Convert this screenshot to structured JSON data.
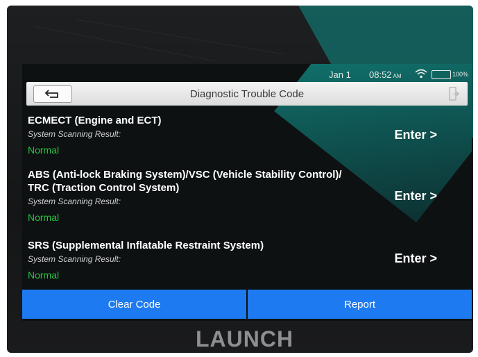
{
  "status_bar": {
    "date": "Jan 1",
    "time": "08:52",
    "ampm": "AM",
    "battery_percent": "100%"
  },
  "header": {
    "title": "Diagnostic Trouble Code",
    "back_icon": "back-arrow-icon",
    "exit_icon": "exit-door-icon"
  },
  "systems": [
    {
      "name_line1": "ECMECT (Engine and ECT)",
      "name_line2": "",
      "result_label": "System Scanning Result:",
      "result_value": "Normal",
      "enter_label": "Enter >"
    },
    {
      "name_line1": "ABS (Anti-lock Braking System)/VSC (Vehicle Stability Control)/",
      "name_line2": "TRC (Traction Control System)",
      "result_label": "System Scanning Result:",
      "result_value": "Normal",
      "enter_label": "Enter >"
    },
    {
      "name_line1": "SRS (Supplemental Inflatable Restraint System)",
      "name_line2": "",
      "result_label": "System Scanning Result:",
      "result_value": "Normal",
      "enter_label": "Enter >"
    }
  ],
  "footer": {
    "clear_label": "Clear Code",
    "report_label": "Report"
  },
  "device": {
    "brand": "LAUNCH"
  },
  "colors": {
    "button_blue": "#1e7af0",
    "normal_green": "#29c341",
    "header_gray": "#e4e4e4"
  }
}
